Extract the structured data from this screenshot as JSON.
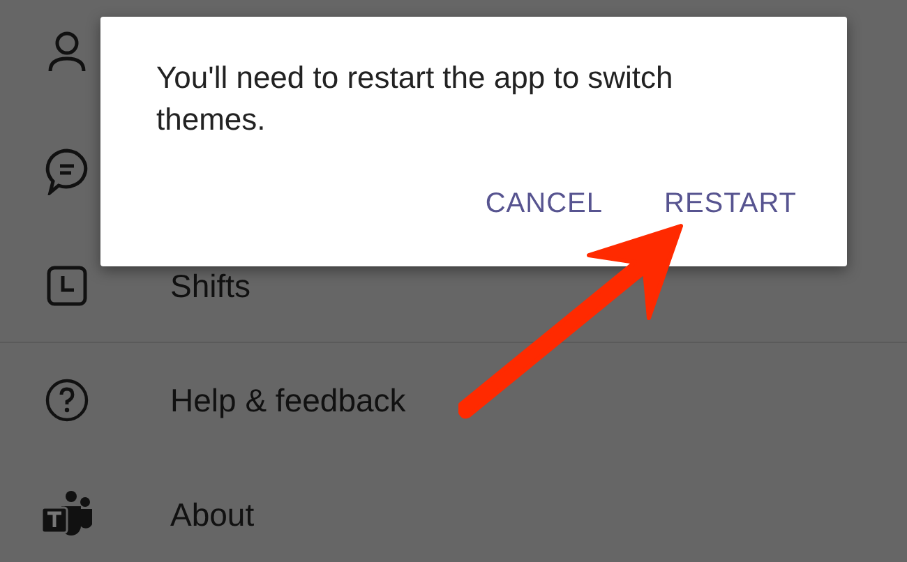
{
  "menu": {
    "items": [
      {
        "kind": "covered"
      },
      {
        "kind": "covered"
      },
      {
        "kind": "entry",
        "label": "Shifts"
      },
      {
        "kind": "entry",
        "label": "Help & feedback"
      },
      {
        "kind": "entry",
        "label": "About"
      }
    ]
  },
  "dialog": {
    "message": "You'll need to restart the app to switch themes.",
    "buttons": [
      "CANCEL",
      "RESTART"
    ]
  }
}
